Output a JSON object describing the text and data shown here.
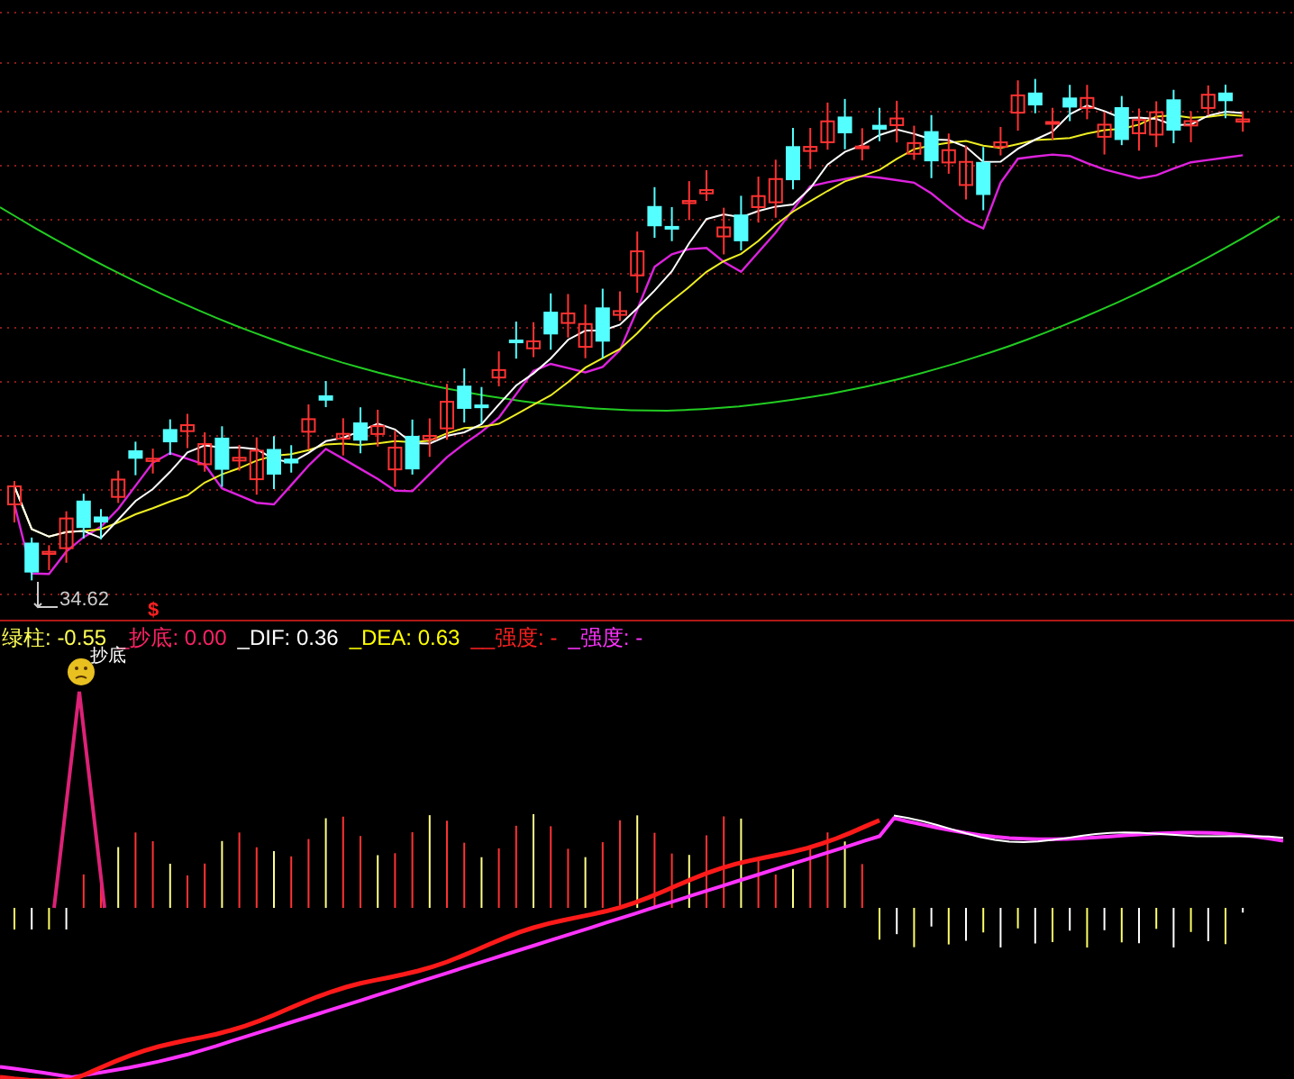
{
  "price_panel": {
    "low_label": "34.62",
    "signal_mark": "$"
  },
  "indicator_panel": {
    "legend": [
      {
        "label": "绿柱:",
        "value": "-0.55",
        "color": "#ffff55"
      },
      {
        "label": "_抄底:",
        "value": "0.00",
        "color": "#ff2266"
      },
      {
        "label": "_DIF:",
        "value": "0.36",
        "color": "#ffffff"
      },
      {
        "label": "_DEA:",
        "value": "0.63",
        "color": "#ffff00"
      },
      {
        "label": "__强度:",
        "value": "-",
        "color": "#ff2020"
      },
      {
        "label": "_强度:",
        "value": "-",
        "color": "#ff33ff"
      }
    ],
    "signal_label": "抄底"
  }
}
